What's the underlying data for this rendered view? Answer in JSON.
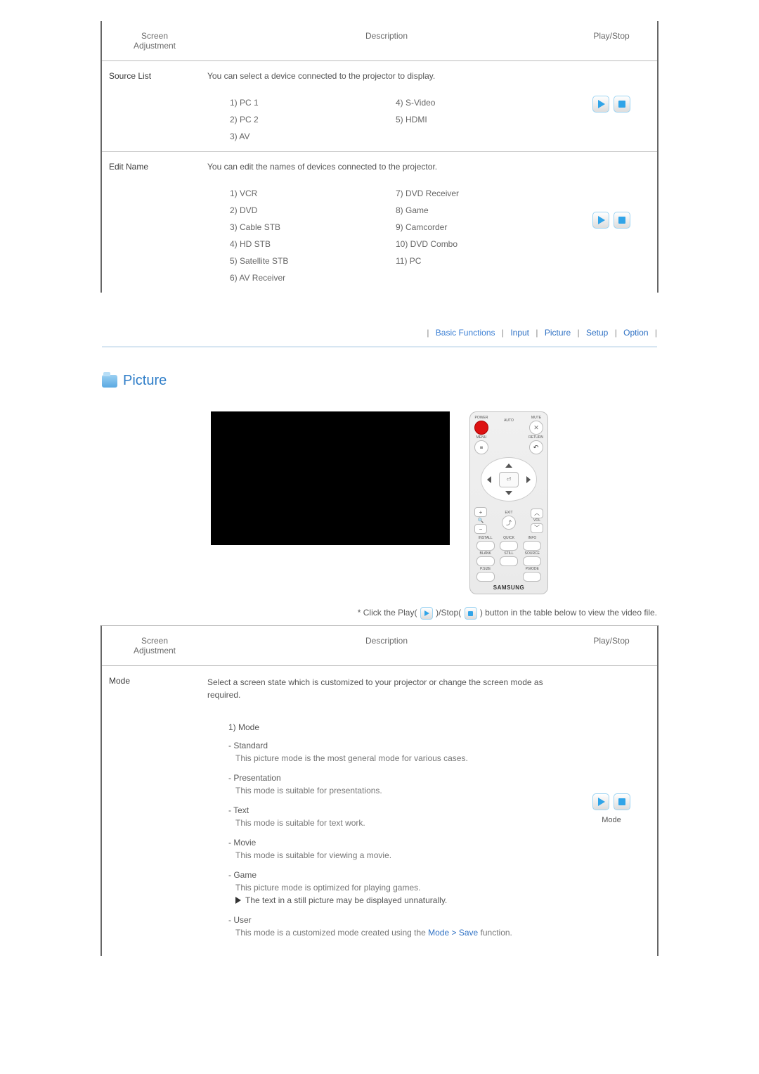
{
  "topTable": {
    "headers": {
      "adj": "Screen\nAdjustment",
      "desc": "Description",
      "ps": "Play/Stop"
    },
    "rows": [
      {
        "label": "Source List",
        "desc": "You can select a device connected to the projector to display.",
        "listLeft": [
          "1) PC 1",
          "2) PC 2",
          "3) AV"
        ],
        "listRight": [
          "4) S-Video",
          "5) HDMI",
          ""
        ]
      },
      {
        "label": "Edit Name",
        "desc": "You can edit the names of devices connected to the projector.",
        "listLeft": [
          "1) VCR",
          "2) DVD",
          "3) Cable STB",
          "4) HD STB",
          "5) Satellite STB",
          "6) AV Receiver"
        ],
        "listRight": [
          "7) DVD Receiver",
          "8) Game",
          "9) Camcorder",
          "10) DVD Combo",
          "11) PC",
          ""
        ]
      }
    ]
  },
  "nav": {
    "items": [
      "Basic Functions",
      "Input",
      "Picture",
      "Setup",
      "Option"
    ],
    "active": "Basic Functions"
  },
  "section": {
    "title": "Picture"
  },
  "remote": {
    "power": "POWER",
    "auto": "AUTO",
    "mute": "MUTE",
    "menu": "MENU",
    "ret": "RETURN",
    "exit": "EXIT",
    "vol": "VOL",
    "install": "INSTALL",
    "quick": "QUICK",
    "info": "INFO",
    "blank": "BLANK",
    "still": "STILL",
    "source": "SOURCE",
    "psize": "P.SIZE",
    "pmode": "P.MODE",
    "brand": "SAMSUNG",
    "enter": "⏎",
    "plus": "+",
    "minus": "−"
  },
  "instruct": {
    "pre": "* Click the Play(",
    "mid": ")/Stop(",
    "post": ") button in the table below to view the video file."
  },
  "pictureTable": {
    "headers": {
      "adj": "Screen\nAdjustment",
      "desc": "Description",
      "ps": "Play/Stop"
    },
    "row": {
      "label": "Mode",
      "desc": "Select a screen state which is customized to your projector or change the screen mode as required.",
      "listTitle": "1) Mode",
      "psCaption": "Mode",
      "items": [
        {
          "name": "- Standard",
          "text": "This picture mode is the most general mode for various cases."
        },
        {
          "name": "- Presentation",
          "text": "This mode is suitable for presentations."
        },
        {
          "name": "- Text",
          "text": "This mode is suitable for text work."
        },
        {
          "name": "- Movie",
          "text": "This mode is suitable for viewing a movie."
        },
        {
          "name": "- Game",
          "text": "This picture mode is optimized for playing games."
        },
        {
          "name": "- User",
          "text": "This mode is a customized mode created using the "
        }
      ],
      "gameNote": "The text in a still picture may be displayed unnaturally.",
      "userLink": "Mode > Save",
      "userTail": " function."
    }
  }
}
